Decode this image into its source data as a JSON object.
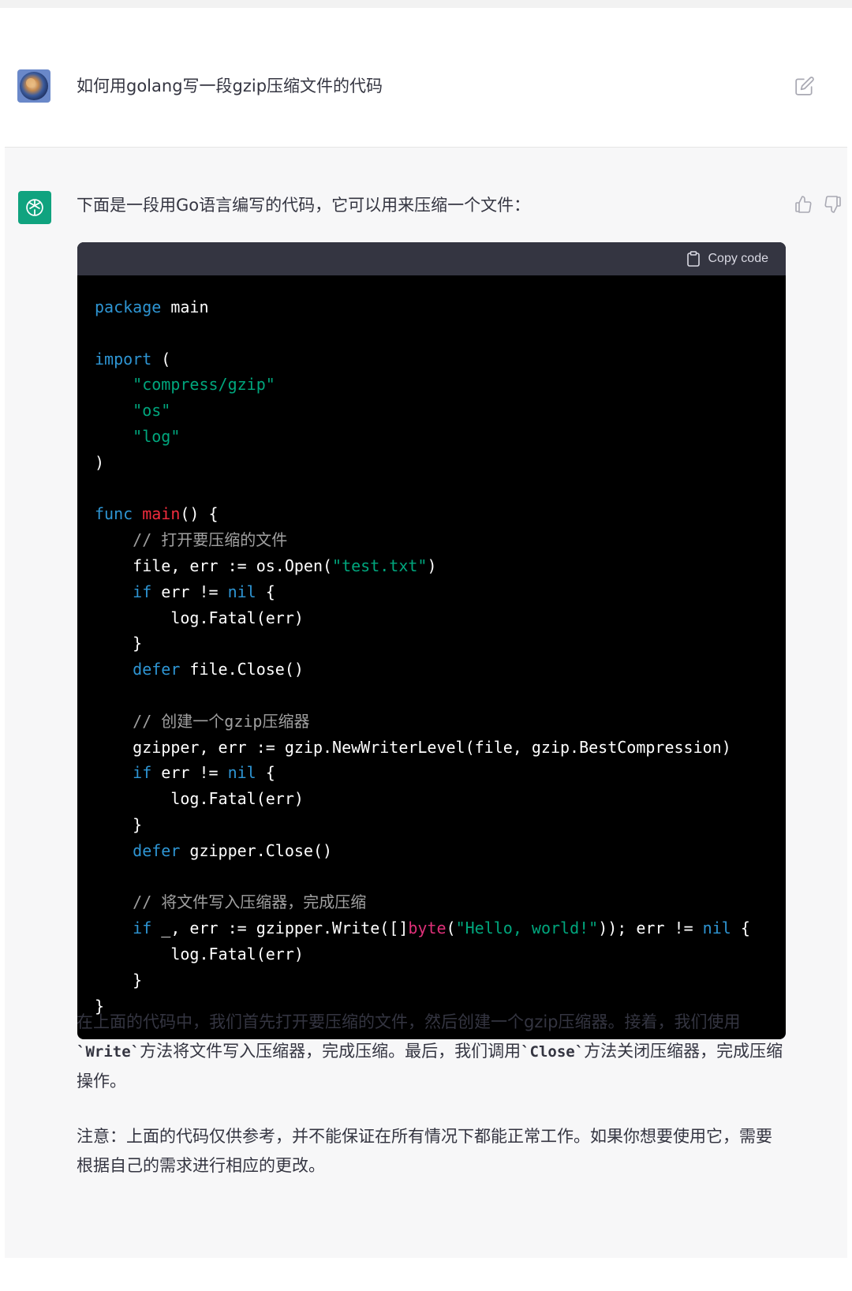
{
  "user_message": {
    "text": "如何用golang写一段gzip压缩文件的代码"
  },
  "assistant": {
    "intro": "下面是一段用Go语言编写的代码，它可以用来压缩一个文件：",
    "copy_label": "Copy code",
    "code_lines": [
      [
        {
          "t": "package",
          "c": "kw"
        },
        {
          "t": " main",
          "c": ""
        }
      ],
      [],
      [
        {
          "t": "import",
          "c": "kw"
        },
        {
          "t": " (",
          "c": ""
        }
      ],
      [
        {
          "t": "    ",
          "c": ""
        },
        {
          "t": "\"compress/gzip\"",
          "c": "str"
        }
      ],
      [
        {
          "t": "    ",
          "c": ""
        },
        {
          "t": "\"os\"",
          "c": "str"
        }
      ],
      [
        {
          "t": "    ",
          "c": ""
        },
        {
          "t": "\"log\"",
          "c": "str"
        }
      ],
      [
        {
          "t": ")",
          "c": ""
        }
      ],
      [],
      [
        {
          "t": "func",
          "c": "kw"
        },
        {
          "t": " ",
          "c": ""
        },
        {
          "t": "main",
          "c": "fn"
        },
        {
          "t": "() {",
          "c": ""
        }
      ],
      [
        {
          "t": "    ",
          "c": ""
        },
        {
          "t": "// 打开要压缩的文件",
          "c": "cm"
        }
      ],
      [
        {
          "t": "    file, err := os.Open(",
          "c": ""
        },
        {
          "t": "\"test.txt\"",
          "c": "str"
        },
        {
          "t": ")",
          "c": ""
        }
      ],
      [
        {
          "t": "    ",
          "c": ""
        },
        {
          "t": "if",
          "c": "kw"
        },
        {
          "t": " err != ",
          "c": ""
        },
        {
          "t": "nil",
          "c": "kw"
        },
        {
          "t": " {",
          "c": ""
        }
      ],
      [
        {
          "t": "        log.Fatal(err)",
          "c": ""
        }
      ],
      [
        {
          "t": "    }",
          "c": ""
        }
      ],
      [
        {
          "t": "    ",
          "c": ""
        },
        {
          "t": "defer",
          "c": "kw"
        },
        {
          "t": " file.Close()",
          "c": ""
        }
      ],
      [],
      [
        {
          "t": "    ",
          "c": ""
        },
        {
          "t": "// 创建一个gzip压缩器",
          "c": "cm"
        }
      ],
      [
        {
          "t": "    gzipper, err := gzip.NewWriterLevel(file, gzip.BestCompression)",
          "c": ""
        }
      ],
      [
        {
          "t": "    ",
          "c": ""
        },
        {
          "t": "if",
          "c": "kw"
        },
        {
          "t": " err != ",
          "c": ""
        },
        {
          "t": "nil",
          "c": "kw"
        },
        {
          "t": " {",
          "c": ""
        }
      ],
      [
        {
          "t": "        log.Fatal(err)",
          "c": ""
        }
      ],
      [
        {
          "t": "    }",
          "c": ""
        }
      ],
      [
        {
          "t": "    ",
          "c": ""
        },
        {
          "t": "defer",
          "c": "kw"
        },
        {
          "t": " gzipper.Close()",
          "c": ""
        }
      ],
      [],
      [
        {
          "t": "    ",
          "c": ""
        },
        {
          "t": "// 将文件写入压缩器，完成压缩",
          "c": "cm"
        }
      ],
      [
        {
          "t": "    ",
          "c": ""
        },
        {
          "t": "if",
          "c": "kw"
        },
        {
          "t": " _, err := gzipper.Write([]",
          "c": ""
        },
        {
          "t": "byte",
          "c": "ty"
        },
        {
          "t": "(",
          "c": ""
        },
        {
          "t": "\"Hello, world!\"",
          "c": "str"
        },
        {
          "t": ")); err != ",
          "c": ""
        },
        {
          "t": "nil",
          "c": "kw"
        },
        {
          "t": " {",
          "c": ""
        }
      ],
      [
        {
          "t": "        log.Fatal(err)",
          "c": ""
        }
      ],
      [
        {
          "t": "    }",
          "c": ""
        }
      ],
      [
        {
          "t": "}",
          "c": ""
        }
      ]
    ],
    "explanation": {
      "p1": "在上面的代码中，我们首先打开要压缩的文件，然后创建一个gzip压缩器。接着，我们使用",
      "code1": "`Write`",
      "p2": "方法将文件写入压缩器，完成压缩。最后，我们调用",
      "code2": "`Close`",
      "p3": "方法关闭压缩器，完成压缩操作。"
    },
    "note": "注意：上面的代码仅供参考，并不能保证在所有情况下都能正常工作。如果你想要使用它，需要根据自己的需求进行相应的更改。"
  },
  "colors": {
    "keyword": "#2e95d3",
    "string": "#00a67d",
    "function": "#f22c3d",
    "type": "#df3079",
    "comment": "#a0a0a0",
    "brand": "#10a37f"
  }
}
